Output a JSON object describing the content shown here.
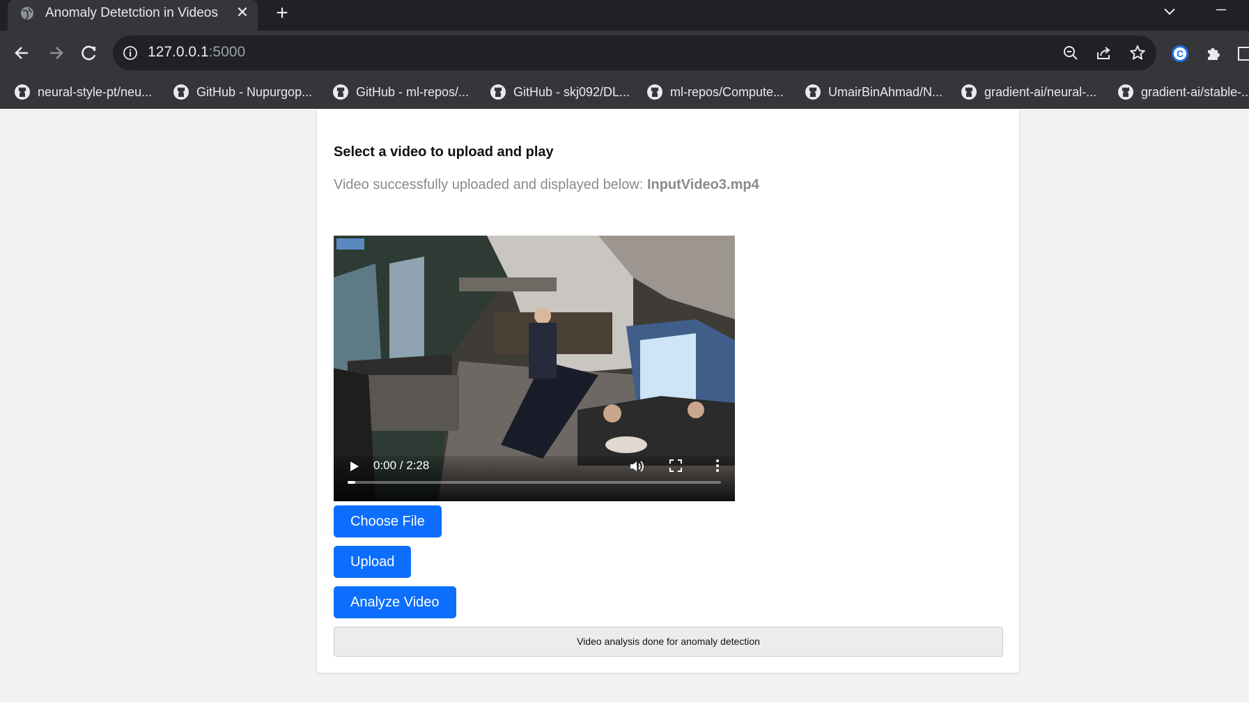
{
  "browser": {
    "tab_title": "Anomaly Detetction in Videos",
    "tab_close": "✕",
    "new_tab": "+",
    "url_host": "127.0.0.1",
    "url_port": ":5000"
  },
  "bookmarks": [
    {
      "label": "neural-style-pt/neu..."
    },
    {
      "label": "GitHub - Nupurgop..."
    },
    {
      "label": "GitHub - ml-repos/..."
    },
    {
      "label": "GitHub - skj092/DL..."
    },
    {
      "label": "ml-repos/Compute..."
    },
    {
      "label": "UmairBinAhmad/N..."
    },
    {
      "label": "gradient-ai/neural-..."
    },
    {
      "label": "gradient-ai/stable-..."
    }
  ],
  "main": {
    "heading": "Select a video to upload and play",
    "status_prefix": "Video successfully uploaded and displayed below:",
    "status_file": "InputVideo3.mp4",
    "video": {
      "time": "0:00 / 2:28",
      "progress": 0.02
    },
    "buttons": {
      "choose": "Choose File",
      "upload": "Upload",
      "analyze": "Analyze Video"
    },
    "result": "Video analysis done for anomaly detection"
  },
  "colors": {
    "accent": "#0d6efd",
    "chrome_dark": "#202124",
    "chrome_mid": "#35363a"
  }
}
